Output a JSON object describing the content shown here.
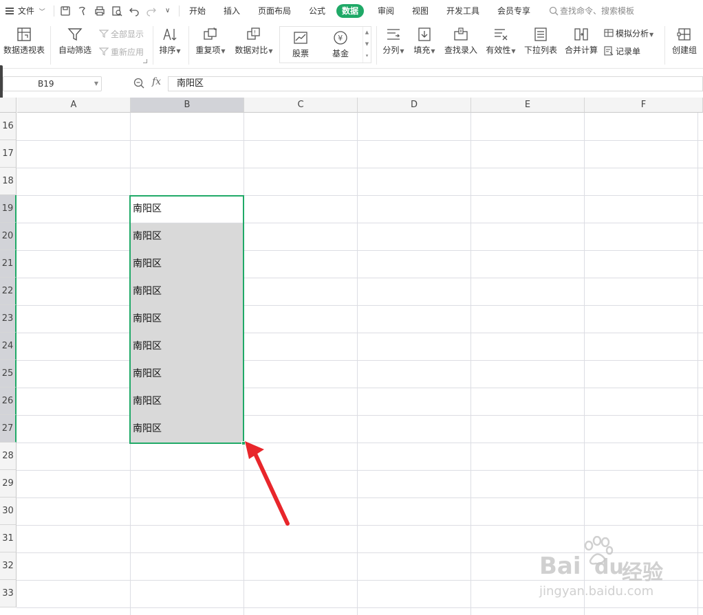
{
  "menubar": {
    "file_label": "文件",
    "tabs": [
      {
        "label": "开始"
      },
      {
        "label": "插入"
      },
      {
        "label": "页面布局"
      },
      {
        "label": "公式"
      },
      {
        "label": "数据"
      },
      {
        "label": "审阅"
      },
      {
        "label": "视图"
      },
      {
        "label": "开发工具"
      },
      {
        "label": "会员专享"
      }
    ],
    "active_tab": "数据",
    "search_placeholder": "查找命令、搜索模板",
    "accent_color": "#1fa967"
  },
  "ribbon": {
    "pivot": "数据透视表",
    "autofilter": "自动筛选",
    "show_all": "全部显示",
    "reapply": "重新应用",
    "sort": "排序",
    "duplicates": "重复项",
    "compare": "数据对比",
    "stock": "股票",
    "fund": "基金",
    "split": "分列",
    "fill": "填充",
    "lookup_entry": "查找录入",
    "validity": "有效性",
    "dropdown_list": "下拉列表",
    "consolidate": "合并计算",
    "whatif": "模拟分析",
    "record_form": "记录单",
    "group": "创建组"
  },
  "formula_bar": {
    "cell_ref": "B19",
    "fx_label": "fx",
    "value": "南阳区"
  },
  "grid": {
    "columns": [
      "A",
      "B",
      "C",
      "D",
      "E",
      "F"
    ],
    "selected_column": "B",
    "rows": [
      "16",
      "17",
      "18",
      "19",
      "20",
      "21",
      "22",
      "23",
      "24",
      "25",
      "26",
      "27",
      "28",
      "29",
      "30",
      "31",
      "32",
      "33"
    ],
    "selected_rows": [
      "19",
      "20",
      "21",
      "22",
      "23",
      "24",
      "25",
      "26",
      "27"
    ],
    "column_b_values": [
      "南阳区",
      "南阳区",
      "南阳区",
      "南阳区",
      "南阳区",
      "南阳区",
      "南阳区",
      "南阳区",
      "南阳区"
    ],
    "selection_color": "#1fa967",
    "arrow_color": "#e8262b"
  },
  "watermark": {
    "brand": "Bai",
    "brand2": "du",
    "suffix": "经验",
    "url": "jingyan.baidu.com"
  }
}
